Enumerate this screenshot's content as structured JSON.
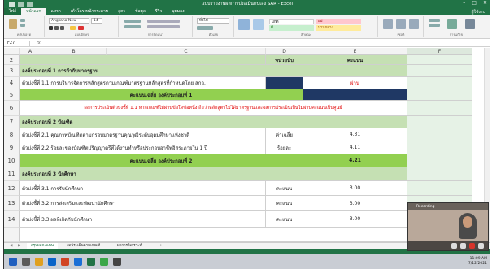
{
  "window": {
    "title": "แบบรายงานผลการประเมินตนเอง SAR - Excel",
    "user": "ผู้ใช้งาน"
  },
  "ribbon_tabs": [
    "ไฟล์",
    "หน้าแรก",
    "แทรก",
    "เค้าโครงหน้ากระดาษ",
    "สูตร",
    "ข้อมูล",
    "รีวิว",
    "มุมมอง"
  ],
  "ribbon": {
    "font_name": "Angsana New",
    "font_size": "14",
    "number_format": "ทั่วไป",
    "style_good": "ดี",
    "style_bad": "แย่",
    "style_neutral": "ปานกลาง",
    "style_normal": "ปกติ",
    "groups": [
      "คลิปบอร์ด",
      "แบบอักษร",
      "การจัดแนว",
      "ตัวเลข",
      "ลักษณะ",
      "เซลล์",
      "การแก้ไข"
    ]
  },
  "formula_bar": {
    "name_box": "F27",
    "fx": "fx",
    "value": ""
  },
  "columns": [
    "A",
    "B",
    "C",
    "D",
    "E",
    "F"
  ],
  "rows": [
    {
      "num": "2",
      "c": "",
      "d": "หน่วยนับ",
      "e": "คะแนน"
    },
    {
      "num": "3",
      "text": "องค์ประกอบที่ 1 การกำกับมาตรฐาน"
    },
    {
      "num": "4",
      "text": "ตัวบ่งชี้ที่ 1.1 การบริหารจัดการหลักสูตรตามเกณฑ์มาตรฐานหลักสูตรที่กำหนดโดย สกอ.",
      "e": "ผ่าน"
    },
    {
      "num": "5",
      "text": "คะแนนเฉลี่ย องค์ประกอบที่ 1"
    },
    {
      "num": "6",
      "text": "ผลการประเมินตัวบ่งชี้ที่ 1.1 หากเกณฑ์ไม่ผ่านข้อใดข้อหนึ่ง ถือว่าหลักสูตรไม่ได้มาตรฐานและผลการประเมินเป็นไม่ผ่านคะแนนเป็นศูนย์"
    },
    {
      "num": "7",
      "text": "องค์ประกอบที่ 2 บัณฑิต"
    },
    {
      "num": "8",
      "text": "ตัวบ่งชี้ที่ 2.1 คุณภาพบัณฑิตตามกรอบมาตรฐานคุณวุฒิระดับอุดมศึกษาแห่งชาติ",
      "d": "ค่าเฉลี่ย",
      "e": "4.31"
    },
    {
      "num": "9",
      "text": "ตัวบ่งชี้ที่ 2.2 ร้อยละของบัณฑิตปริญญาตรีที่ได้งานทำหรือประกอบอาชีพอิสระภายใน 1 ปี",
      "d": "ร้อยละ",
      "e": "4.11"
    },
    {
      "num": "10",
      "text": "คะแนนเฉลี่ย องค์ประกอบที่ 2",
      "e": "4.21"
    },
    {
      "num": "11",
      "text": "องค์ประกอบที่ 3 นักศึกษา"
    },
    {
      "num": "12",
      "text": "ตัวบ่งชี้ที่ 3.1 การรับนักศึกษา",
      "d": "คะแนน",
      "e": "3.00"
    },
    {
      "num": "13",
      "text": "ตัวบ่งชี้ที่ 3.2 การส่งเสริมและพัฒนานักศึกษา",
      "d": "คะแนน",
      "e": "3.00"
    },
    {
      "num": "14",
      "text": "ตัวบ่งชี้ที่ 3.3 ผลที่เกิดกับนักศึกษา",
      "d": "คะแนน",
      "e": "3.00"
    }
  ],
  "sheet_tabs": [
    "สรุปผลคะแนน",
    "ผลประเมินตามเกณฑ์",
    "ผลการวิเคราะห์"
  ],
  "sheet_add": "+",
  "video": {
    "label": "Recording"
  },
  "tray": {
    "time": "11:09 AM",
    "date": "7/12/2021"
  },
  "colors": {
    "excel_green": "#217346",
    "header_green": "#c5e0b3",
    "summary_green": "#92d050",
    "dark_cell": "#1f3864",
    "red_text": "#e00000"
  }
}
